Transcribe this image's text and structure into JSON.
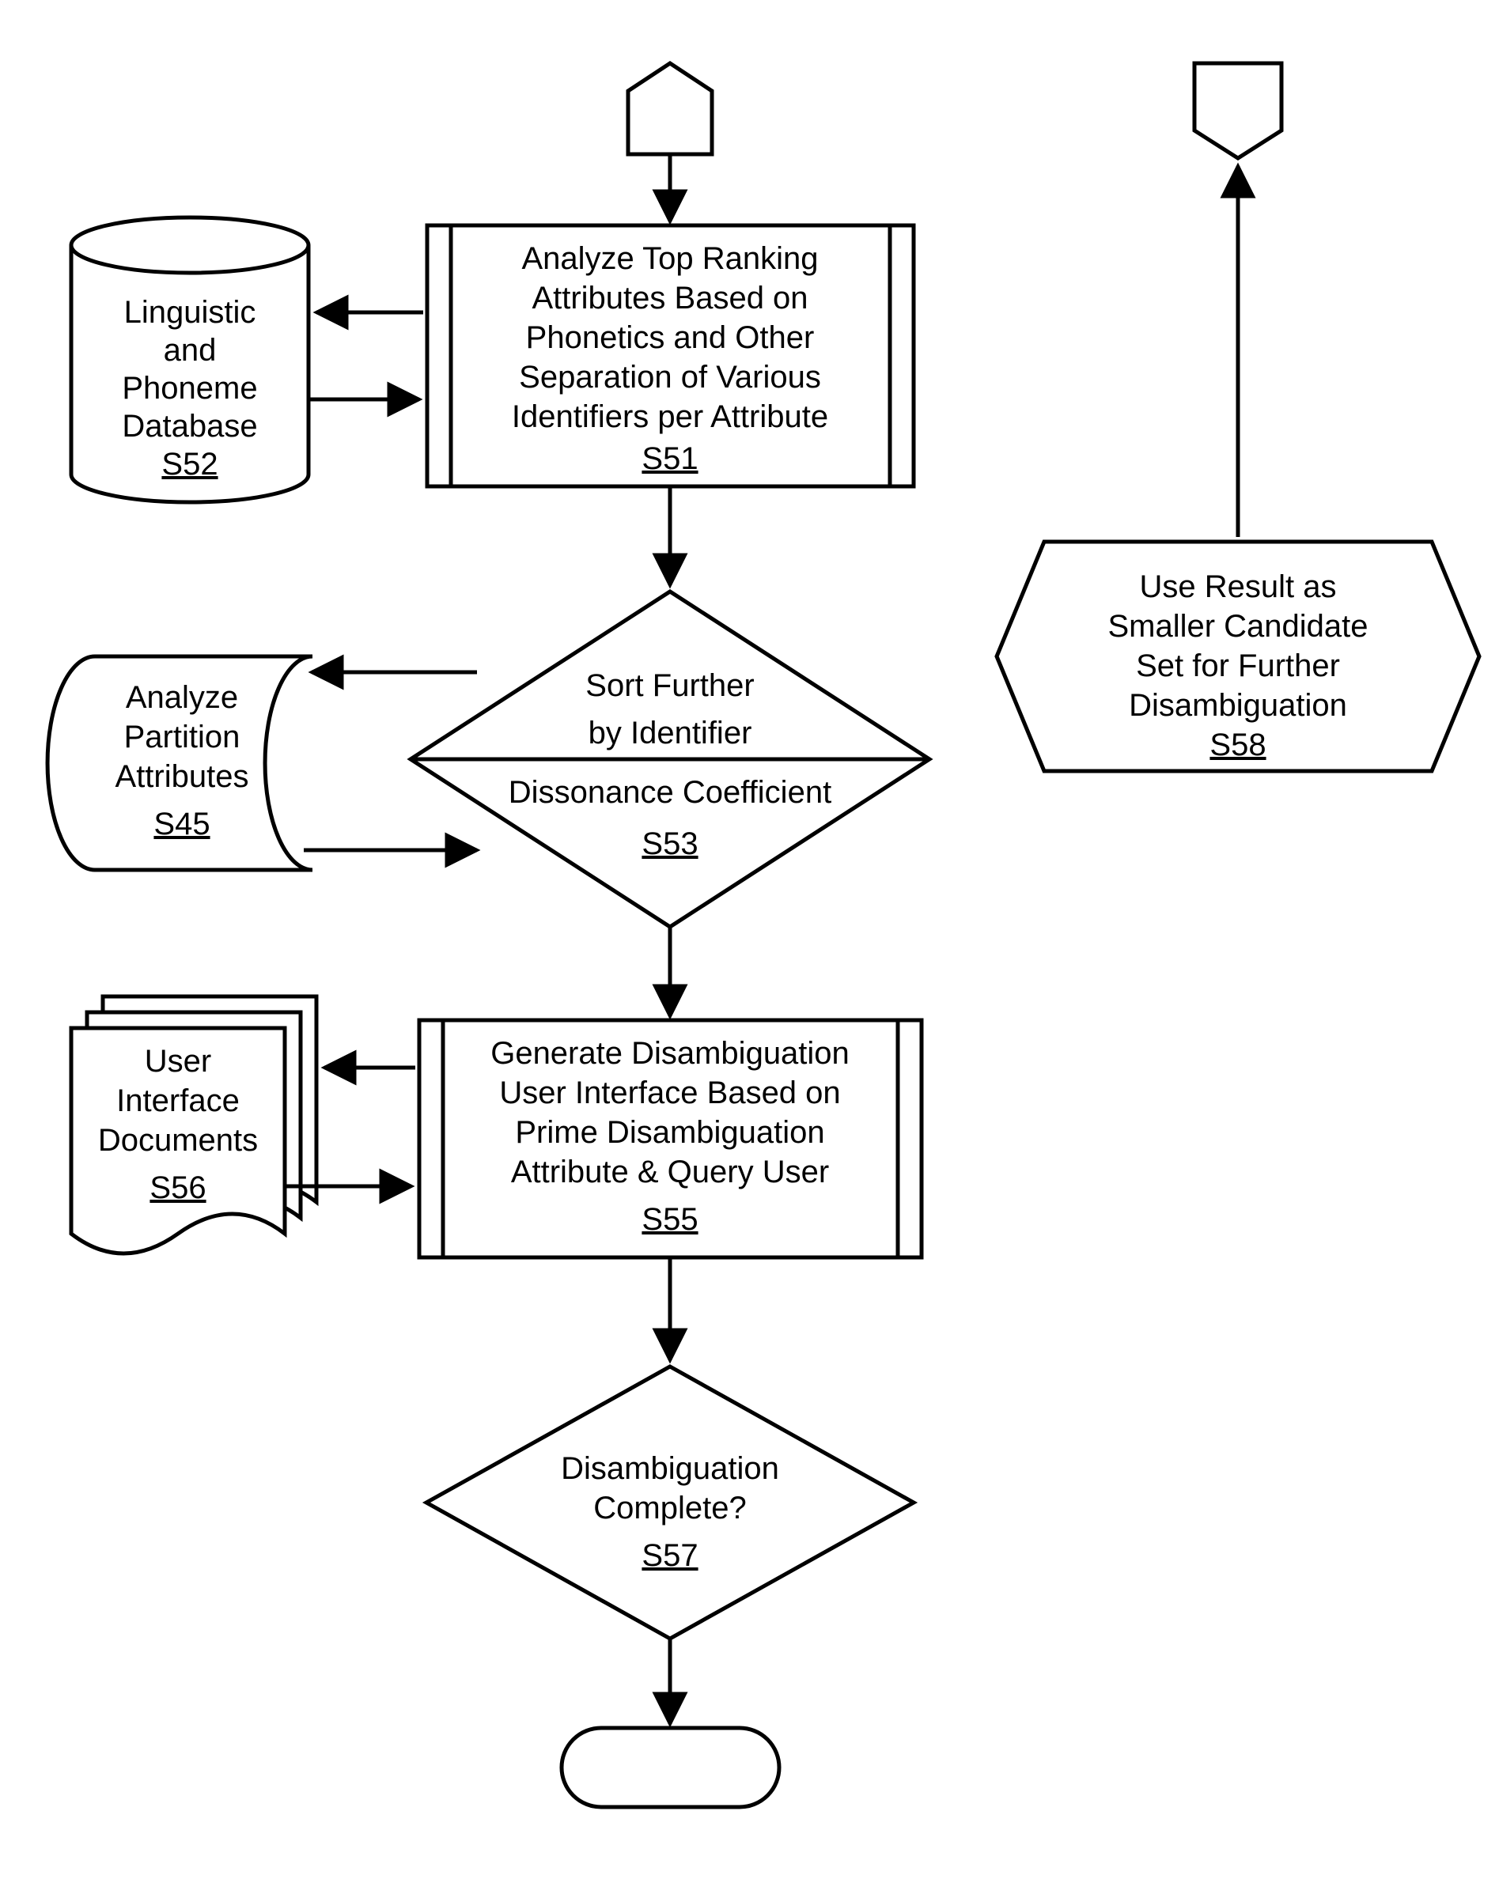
{
  "s52": {
    "l1": "Linguistic",
    "l2": "and",
    "l3": "Phoneme",
    "l4": "Database",
    "step": "S52"
  },
  "s51": {
    "l1": "Analyze Top Ranking",
    "l2": "Attributes Based on",
    "l3": "Phonetics and Other",
    "l4": "Separation of Various",
    "l5": "Identifiers per Attribute",
    "step": "S51"
  },
  "s45": {
    "l1": "Analyze",
    "l2": "Partition",
    "l3": "Attributes",
    "step": "S45"
  },
  "s53": {
    "l1": "Sort Further",
    "l2": "by Identifier",
    "l3": "Dissonance Coefficient",
    "step": "S53"
  },
  "s56": {
    "l1": "User",
    "l2": "Interface",
    "l3": "Documents",
    "step": "S56"
  },
  "s55": {
    "l1": "Generate Disambiguation",
    "l2": "User Interface Based on",
    "l3": "Prime Disambiguation",
    "l4": "Attribute & Query User",
    "step": "S55"
  },
  "s57": {
    "l1": "Disambiguation",
    "l2": "Complete?",
    "step": "S57"
  },
  "s58": {
    "l1": "Use Result as",
    "l2": "Smaller Candidate",
    "l3": "Set for Further",
    "l4": "Disambiguation",
    "step": "S58"
  }
}
